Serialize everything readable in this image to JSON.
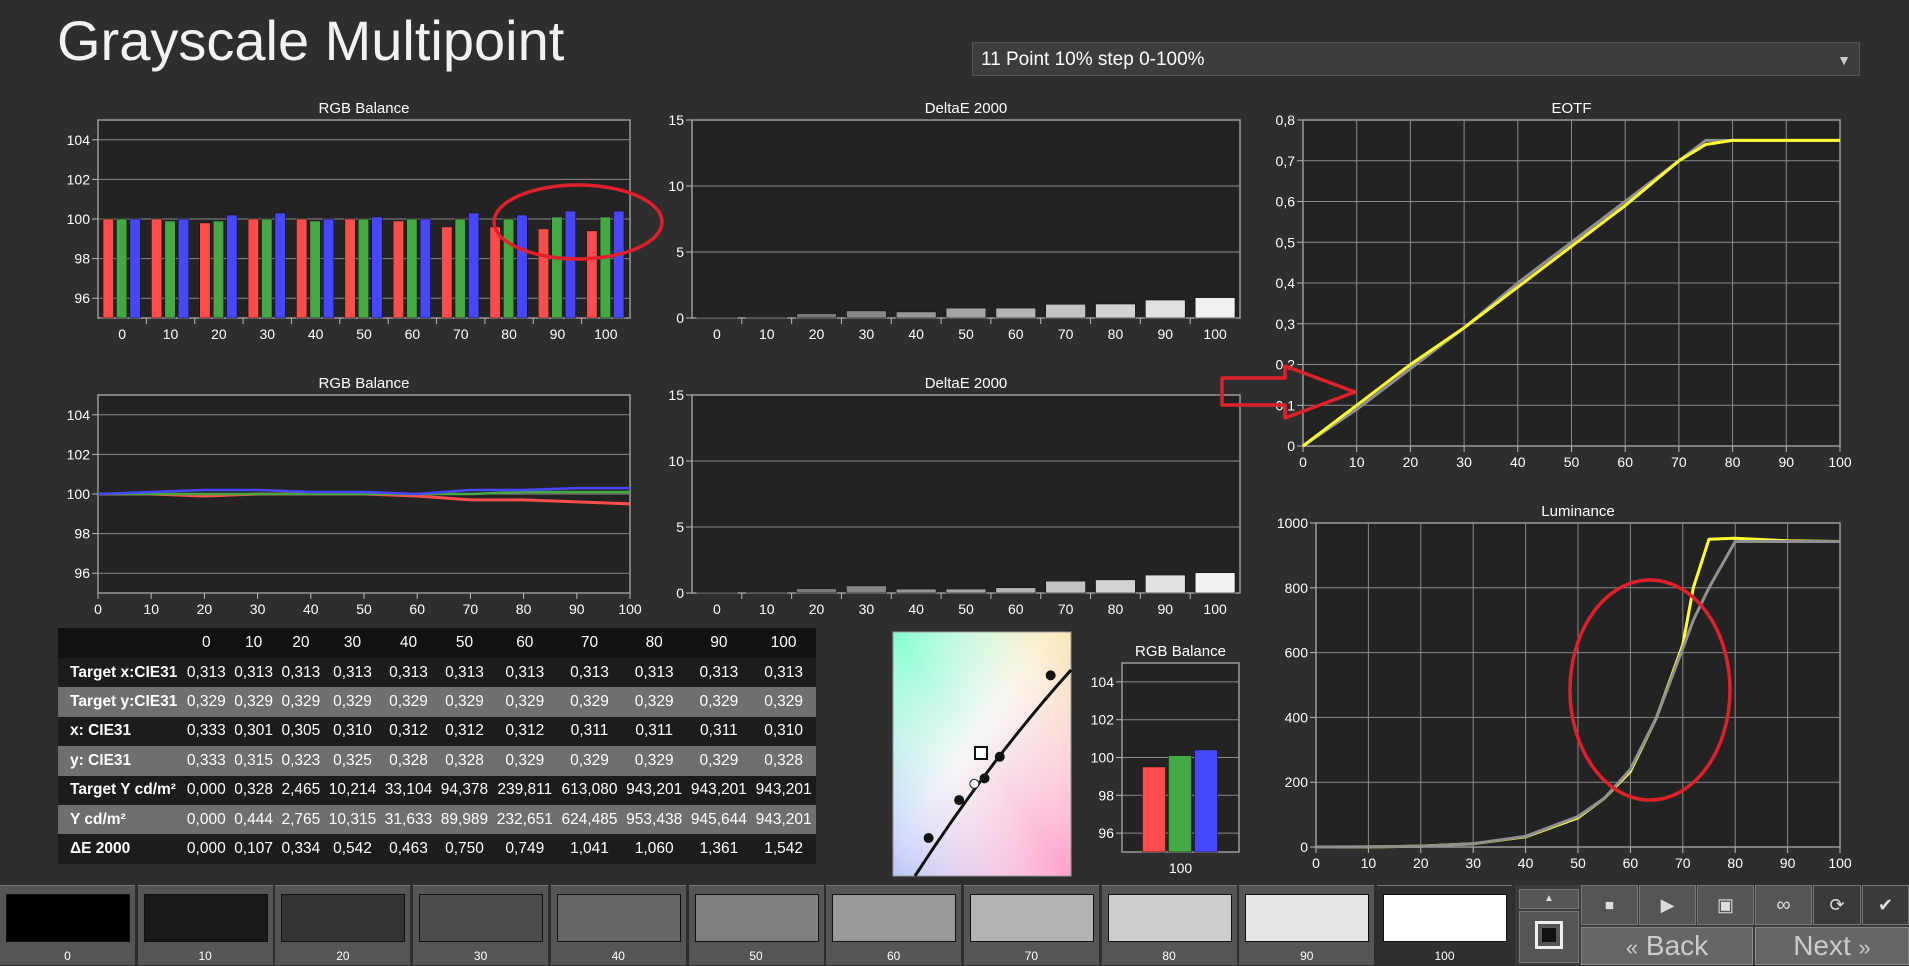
{
  "title": "Grayscale Multipoint",
  "preset": {
    "value": "11 Point 10% step 0-100%"
  },
  "colors": {
    "red": "#ff4d4d",
    "green": "#44a844",
    "blue": "#4747ff",
    "yellow": "#ffff33",
    "annotation": "#e0202a"
  },
  "chart_data": [
    {
      "id": "rgb-balance-bars",
      "type": "bar",
      "title": "RGB Balance",
      "categories": [
        "0",
        "10",
        "20",
        "30",
        "40",
        "50",
        "60",
        "70",
        "80",
        "90",
        "100"
      ],
      "ylim": [
        95,
        105
      ],
      "yticks": [
        "96",
        "98",
        "100",
        "102",
        "104"
      ],
      "series": [
        {
          "values": [
            100.0,
            100.0,
            99.8,
            100.0,
            100.0,
            100.0,
            99.9,
            99.6,
            99.6,
            99.5,
            99.4
          ]
        },
        {
          "values": [
            100.0,
            99.9,
            99.9,
            100.0,
            99.9,
            100.0,
            100.0,
            100.0,
            100.0,
            100.1,
            100.1
          ]
        },
        {
          "values": [
            100.0,
            100.0,
            100.2,
            100.3,
            100.0,
            100.1,
            100.0,
            100.3,
            100.2,
            100.4,
            100.4
          ]
        }
      ]
    },
    {
      "id": "deltae-bars-top",
      "type": "bar",
      "title": "DeltaE 2000",
      "categories": [
        "0",
        "10",
        "20",
        "30",
        "40",
        "50",
        "60",
        "70",
        "80",
        "90",
        "100"
      ],
      "ylim": [
        0,
        15
      ],
      "yticks": [
        "0",
        "5",
        "10",
        "15"
      ],
      "values": [
        0.0,
        0.107,
        0.334,
        0.542,
        0.463,
        0.75,
        0.749,
        1.041,
        1.06,
        1.361,
        1.542
      ]
    },
    {
      "id": "eotf-line",
      "type": "line",
      "title": "EOTF",
      "xlim": [
        0,
        100
      ],
      "ylim": [
        0,
        0.8
      ],
      "xticks": [
        "0",
        "10",
        "20",
        "30",
        "40",
        "50",
        "60",
        "70",
        "80",
        "90",
        "100"
      ],
      "yticks": [
        "0",
        "0,1",
        "0,2",
        "0,3",
        "0,4",
        "0,5",
        "0,6",
        "0,7",
        "0,8"
      ],
      "x": [
        0,
        10,
        20,
        30,
        40,
        50,
        60,
        70,
        75,
        80,
        90,
        100
      ],
      "series": [
        {
          "values": [
            0.0,
            0.09,
            0.19,
            0.29,
            0.4,
            0.5,
            0.6,
            0.7,
            0.75,
            0.75,
            0.75,
            0.75
          ]
        },
        {
          "values": [
            0.0,
            0.1,
            0.2,
            0.29,
            0.39,
            0.49,
            0.59,
            0.7,
            0.74,
            0.75,
            0.75,
            0.75
          ]
        }
      ]
    },
    {
      "id": "rgb-balance-lines",
      "type": "line",
      "title": "RGB Balance",
      "xlim": [
        0,
        100
      ],
      "ylim": [
        95,
        105
      ],
      "xticks": [
        "0",
        "10",
        "20",
        "30",
        "40",
        "50",
        "60",
        "70",
        "80",
        "90",
        "100"
      ],
      "yticks": [
        "96",
        "98",
        "100",
        "102",
        "104"
      ],
      "x": [
        0,
        10,
        20,
        30,
        40,
        50,
        60,
        70,
        80,
        90,
        100
      ],
      "series": [
        {
          "values": [
            100.0,
            100.0,
            99.9,
            100.0,
            100.0,
            100.0,
            99.9,
            99.7,
            99.7,
            99.6,
            99.5
          ]
        },
        {
          "values": [
            100.0,
            100.0,
            100.0,
            100.0,
            100.0,
            100.0,
            100.0,
            100.0,
            100.1,
            100.1,
            100.1
          ]
        },
        {
          "values": [
            100.0,
            100.1,
            100.2,
            100.2,
            100.1,
            100.1,
            100.0,
            100.2,
            100.2,
            100.3,
            100.3
          ]
        }
      ]
    },
    {
      "id": "deltae-bars-bottom",
      "type": "bar",
      "title": "DeltaE 2000",
      "categories": [
        "0",
        "10",
        "20",
        "30",
        "40",
        "50",
        "60",
        "70",
        "80",
        "90",
        "100"
      ],
      "ylim": [
        0,
        15
      ],
      "yticks": [
        "0",
        "5",
        "10",
        "15"
      ],
      "values": [
        0.0,
        0.107,
        0.334,
        0.542,
        0.3,
        0.3,
        0.4,
        0.9,
        1.0,
        1.36,
        1.54
      ]
    },
    {
      "id": "luminance-line",
      "type": "line",
      "title": "Luminance",
      "xlim": [
        0,
        100
      ],
      "ylim": [
        0,
        1000
      ],
      "xticks": [
        "0",
        "10",
        "20",
        "30",
        "40",
        "50",
        "60",
        "70",
        "80",
        "90",
        "100"
      ],
      "yticks": [
        "0",
        "200",
        "400",
        "600",
        "800",
        "1000"
      ],
      "x": [
        0,
        10,
        20,
        30,
        40,
        50,
        55,
        60,
        65,
        70,
        72,
        75,
        80,
        90,
        100
      ],
      "series": [
        {
          "values": [
            0,
            0.4,
            2.8,
            10.3,
            31.6,
            90,
            150,
            233,
            400,
            624,
            800,
            950,
            953,
            945,
            943
          ]
        },
        {
          "values": [
            0,
            0.3,
            2.5,
            10.2,
            33,
            94,
            150,
            240,
            400,
            613,
            700,
            800,
            943,
            943,
            943
          ]
        }
      ]
    },
    {
      "id": "rgb-balance-single",
      "type": "bar",
      "title": "RGB Balance",
      "categories": [
        "100"
      ],
      "ylim": [
        95,
        105
      ],
      "yticks": [
        "96",
        "98",
        "100",
        "102",
        "104"
      ],
      "series": [
        {
          "values": [
            99.5
          ]
        },
        {
          "values": [
            100.1
          ]
        },
        {
          "values": [
            100.4
          ]
        }
      ]
    },
    {
      "id": "cie-chromaticity",
      "type": "scatter",
      "points": [
        [
          0.31,
          0.32
        ],
        [
          0.33,
          0.33
        ],
        [
          0.28,
          0.29
        ],
        [
          0.36,
          0.37
        ],
        [
          0.22,
          0.22
        ],
        [
          0.46,
          0.52
        ]
      ]
    }
  ],
  "table": {
    "columns": [
      "0",
      "10",
      "20",
      "30",
      "40",
      "50",
      "60",
      "70",
      "80",
      "90",
      "100"
    ],
    "rows": [
      {
        "label": "Target x:CIE31",
        "values": [
          "0,313",
          "0,313",
          "0,313",
          "0,313",
          "0,313",
          "0,313",
          "0,313",
          "0,313",
          "0,313",
          "0,313",
          "0,313"
        ]
      },
      {
        "label": "Target y:CIE31",
        "values": [
          "0,329",
          "0,329",
          "0,329",
          "0,329",
          "0,329",
          "0,329",
          "0,329",
          "0,329",
          "0,329",
          "0,329",
          "0,329"
        ]
      },
      {
        "label": "x: CIE31",
        "values": [
          "0,333",
          "0,301",
          "0,305",
          "0,310",
          "0,312",
          "0,312",
          "0,312",
          "0,311",
          "0,311",
          "0,311",
          "0,310"
        ]
      },
      {
        "label": "y: CIE31",
        "values": [
          "0,333",
          "0,315",
          "0,323",
          "0,325",
          "0,328",
          "0,328",
          "0,329",
          "0,329",
          "0,329",
          "0,329",
          "0,328"
        ]
      },
      {
        "label": "Target Y cd/m²",
        "values": [
          "0,000",
          "0,328",
          "2,465",
          "10,214",
          "33,104",
          "94,378",
          "239,811",
          "613,080",
          "943,201",
          "943,201",
          "943,201"
        ]
      },
      {
        "label": "Y cd/m²",
        "values": [
          "0,000",
          "0,444",
          "2,765",
          "10,315",
          "31,633",
          "89,989",
          "232,651",
          "624,485",
          "953,438",
          "945,644",
          "943,201"
        ]
      },
      {
        "label": "ΔE 2000",
        "values": [
          "0,000",
          "0,107",
          "0,334",
          "0,542",
          "0,463",
          "0,750",
          "0,749",
          "1,041",
          "1,060",
          "1,361",
          "1,542"
        ]
      }
    ]
  },
  "swatches": [
    {
      "label": "0",
      "color": "#000000"
    },
    {
      "label": "10",
      "color": "#1a1a1a"
    },
    {
      "label": "20",
      "color": "#333333"
    },
    {
      "label": "30",
      "color": "#4d4d4d"
    },
    {
      "label": "40",
      "color": "#666666"
    },
    {
      "label": "50",
      "color": "#808080"
    },
    {
      "label": "60",
      "color": "#999999"
    },
    {
      "label": "70",
      "color": "#b3b3b3"
    },
    {
      "label": "80",
      "color": "#cccccc"
    },
    {
      "label": "90",
      "color": "#e6e6e6"
    },
    {
      "label": "100",
      "color": "#ffffff"
    }
  ],
  "controls": {
    "back_label": "Back",
    "next_label": "Next"
  }
}
